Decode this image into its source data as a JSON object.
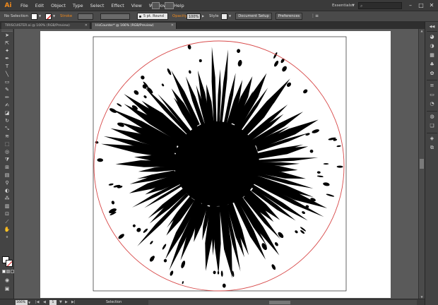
{
  "app": {
    "logo": "Ai",
    "menu": [
      "File",
      "Edit",
      "Object",
      "Type",
      "Select",
      "Effect",
      "View",
      "Window",
      "Help"
    ],
    "workspace": "Essentials",
    "search_placeholder": ""
  },
  "control_bar": {
    "selection_label": "No Selection",
    "stroke_label": "Stroke",
    "stroke_profile": "5 pt. Round",
    "opacity_label": "Opacity",
    "opacity_value": "100%",
    "style_label": "Style",
    "document_setup": "Document Setup",
    "preferences": "Preferences"
  },
  "tabs": [
    {
      "label": "TIRISCUISTER.ai @ 100% (RGB/Preview)",
      "active": false
    },
    {
      "label": "IrisCounter* @ 166% (RGB/Preview)",
      "active": true
    }
  ],
  "tools": [
    "selection-tool",
    "direct-selection-tool",
    "magic-wand-tool",
    "lasso-tool",
    "pen-tool",
    "type-tool",
    "line-tool",
    "rectangle-tool",
    "paintbrush-tool",
    "pencil-tool",
    "blob-brush-tool",
    "eraser-tool",
    "rotate-tool",
    "scale-tool",
    "width-tool",
    "free-transform-tool",
    "shape-builder-tool",
    "perspective-tool",
    "mesh-tool",
    "gradient-tool",
    "eyedropper-tool",
    "blend-tool",
    "symbol-sprayer-tool",
    "graph-tool",
    "artboard-tool",
    "slice-tool",
    "hand-tool",
    "zoom-tool"
  ],
  "right_panel_icons": [
    "color-panel-icon",
    "color-guide-icon",
    "swatches-icon",
    "brushes-icon",
    "symbols-icon",
    "stroke-panel-icon",
    "gradient-panel-icon",
    "transparency-icon",
    "appearance-icon",
    "graphic-styles-icon",
    "layers-icon",
    "artboards-icon"
  ],
  "status": {
    "zoom": "166%",
    "page": "1",
    "tool": "Selection"
  },
  "colors": {
    "accent_orange": "#f08a1c",
    "guide_circle": "#d84a4a",
    "artwork": "#000000"
  }
}
